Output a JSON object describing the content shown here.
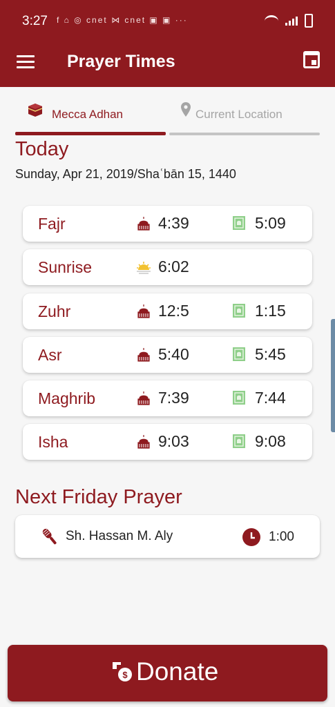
{
  "status_bar": {
    "time": "3:27",
    "icons_text": "f ⌂ ◎ cnet ⋈ cnet ▣ ▣ ···"
  },
  "app_bar": {
    "title": "Prayer Times",
    "menu_icon": "menu-icon",
    "calendar_icon": "calendar-icon"
  },
  "tabs": [
    {
      "label": "Mecca Adhan",
      "icon": "kaaba-icon",
      "active": true
    },
    {
      "label": "Current Location",
      "icon": "location-pin-icon",
      "active": false
    }
  ],
  "today": {
    "title": "Today",
    "date": "Sunday, Apr 21, 2019/Shaʿbān 15, 1440"
  },
  "prayers": [
    {
      "name": "Fajr",
      "adhan": "4:39",
      "iqama": "5:09"
    },
    {
      "name": "Sunrise",
      "adhan": "6:02",
      "iqama": ""
    },
    {
      "name": "Zuhr",
      "adhan": "12:5",
      "iqama": "1:15"
    },
    {
      "name": "Asr",
      "adhan": "5:40",
      "iqama": "5:45"
    },
    {
      "name": "Maghrib",
      "adhan": "7:39",
      "iqama": "7:44"
    },
    {
      "name": "Isha",
      "adhan": "9:03",
      "iqama": "9:08"
    }
  ],
  "friday": {
    "title": "Next Friday Prayer",
    "imam": "Sh. Hassan M. Aly",
    "time": "1:00"
  },
  "donate": {
    "label": "Donate"
  },
  "colors": {
    "primary": "#8e1a1f",
    "iqama_green": "#8fcf8a",
    "sun_yellow": "#f2c232"
  }
}
